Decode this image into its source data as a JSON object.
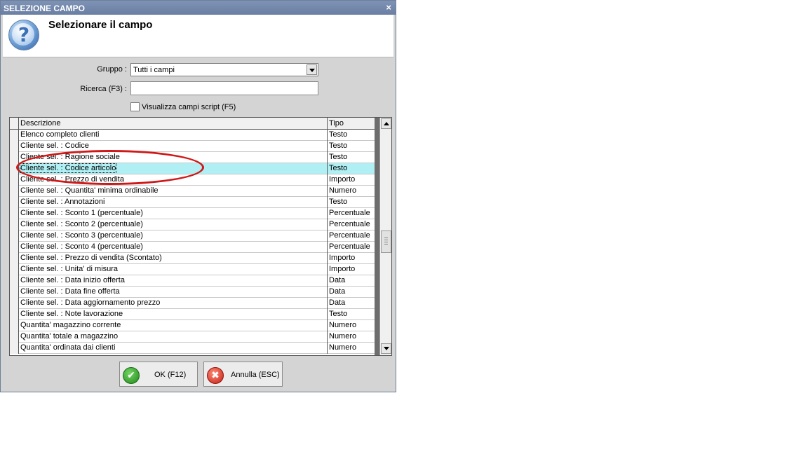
{
  "window": {
    "title": "SELEZIONE CAMPO",
    "close_glyph": "×"
  },
  "header": {
    "title": "Selezionare il campo",
    "icon": "question-icon"
  },
  "form": {
    "gruppo_label": "Gruppo :",
    "gruppo_value": "Tutti i campi",
    "ricerca_label": "Ricerca (F3) :",
    "ricerca_value": "",
    "script_checkbox_label": "Visualizza campi script (F5)",
    "script_checkbox_checked": false
  },
  "table": {
    "columns": [
      "Descrizione",
      "Tipo"
    ],
    "selected_index": 3,
    "rows": [
      {
        "desc": "Elenco completo clienti",
        "type": "Testo"
      },
      {
        "desc": "Cliente sel. : Codice",
        "type": "Testo"
      },
      {
        "desc": "Cliente sel. : Ragione sociale",
        "type": "Testo"
      },
      {
        "desc": "Cliente sel. : Codice articolo",
        "type": "Testo"
      },
      {
        "desc": "Cliente sel. : Prezzo di vendita",
        "type": "Importo"
      },
      {
        "desc": "Cliente sel. : Quantita' minima ordinabile",
        "type": "Numero"
      },
      {
        "desc": "Cliente sel. : Annotazioni",
        "type": "Testo"
      },
      {
        "desc": "Cliente sel. : Sconto 1 (percentuale)",
        "type": "Percentuale"
      },
      {
        "desc": "Cliente sel. : Sconto 2 (percentuale)",
        "type": "Percentuale"
      },
      {
        "desc": "Cliente sel. : Sconto 3 (percentuale)",
        "type": "Percentuale"
      },
      {
        "desc": "Cliente sel. : Sconto 4 (percentuale)",
        "type": "Percentuale"
      },
      {
        "desc": "Cliente sel. : Prezzo di vendita (Scontato)",
        "type": "Importo"
      },
      {
        "desc": "Cliente sel. : Unita' di misura",
        "type": "Importo"
      },
      {
        "desc": "Cliente sel. : Data inizio offerta",
        "type": "Data"
      },
      {
        "desc": "Cliente sel. : Data fine offerta",
        "type": "Data"
      },
      {
        "desc": "Cliente sel. : Data aggiornamento prezzo",
        "type": "Data"
      },
      {
        "desc": "Cliente sel. : Note lavorazione",
        "type": "Testo"
      },
      {
        "desc": "Quantita' magazzino corrente",
        "type": "Numero"
      },
      {
        "desc": "Quantita' totale a magazzino",
        "type": "Numero"
      },
      {
        "desc": "Quantita' ordinata dai clienti",
        "type": "Numero"
      }
    ]
  },
  "buttons": {
    "ok_label": "OK (F12)",
    "ok_icon": "check-icon",
    "cancel_label": "Annulla (ESC)",
    "cancel_icon": "cancel-icon"
  },
  "colors": {
    "titlebar": "#7084a8",
    "selected_row": "#b0f0f4",
    "annotation": "#d01818"
  }
}
